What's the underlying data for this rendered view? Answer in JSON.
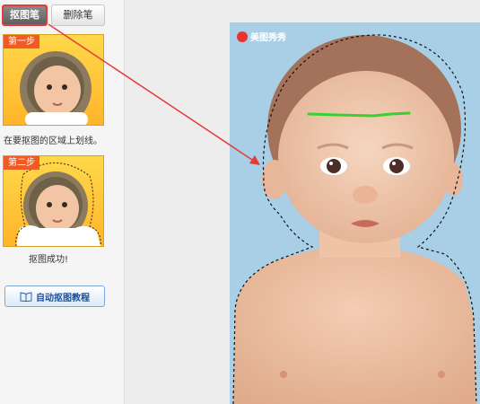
{
  "tabs": {
    "cutout_pen": "抠图笔",
    "erase_pen": "删除笔"
  },
  "steps": [
    {
      "badge": "第一步",
      "description": "在要抠图的区域上划线。"
    },
    {
      "badge": "第二步",
      "description": "抠图成功!"
    }
  ],
  "tutorial_button": "自动抠图教程",
  "canvas": {
    "watermark": "美图秀秀"
  },
  "colors": {
    "highlight_red": "#e53b3b",
    "stroke_green": "#38d12f",
    "canvas_bg": "#a9cfe6",
    "step_bg": "#ffc93a"
  }
}
